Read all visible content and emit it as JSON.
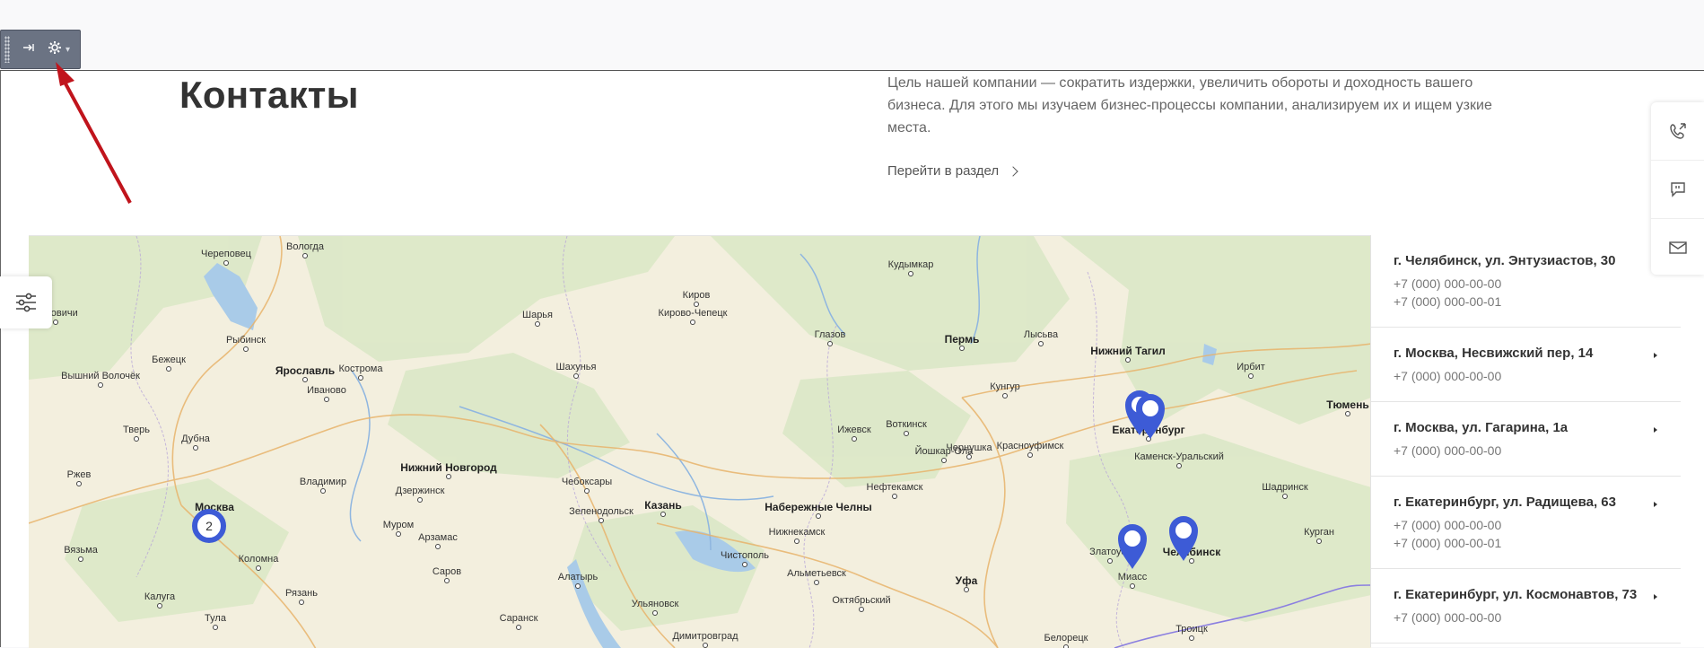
{
  "page": {
    "title": "Контакты",
    "intro": "Цель нашей компании — сократить издержки, увеличить обороты и доходность вашего бизнеса. Для этого мы изучаем бизнес-процессы компании, анализируем их и ищем узкие места.",
    "section_link": "Перейти в раздел"
  },
  "admin_toolbar": {
    "icons": [
      "grip-icon",
      "pin-icon",
      "gear-icon",
      "chevron-down-icon"
    ],
    "accent": "#6b7383"
  },
  "map": {
    "cluster_count": "2",
    "marker_color": "#3d5bd6",
    "cities": [
      {
        "name": "Череповец"
      },
      {
        "name": "Вологда"
      },
      {
        "name": "Кудымкар"
      },
      {
        "name": "Киров"
      },
      {
        "name": "Кирово-Чепецк"
      },
      {
        "name": "Шарья"
      },
      {
        "name": "Глазов"
      },
      {
        "name": "Пермь"
      },
      {
        "name": "Лысьва"
      },
      {
        "name": "Нижний Тагил"
      },
      {
        "name": "Ирбит"
      },
      {
        "name": "Боровичи"
      },
      {
        "name": "Рыбинск"
      },
      {
        "name": "Бежецк"
      },
      {
        "name": "Вышний Волочёк"
      },
      {
        "name": "Ярославль"
      },
      {
        "name": "Кострома"
      },
      {
        "name": "Шахунья"
      },
      {
        "name": "Кунгур"
      },
      {
        "name": "Екатеринбург"
      },
      {
        "name": "Тюмень"
      },
      {
        "name": "Иваново"
      },
      {
        "name": "Тверь"
      },
      {
        "name": "Дубна"
      },
      {
        "name": "Ижевск"
      },
      {
        "name": "Воткинск"
      },
      {
        "name": "Йошкар-Ола"
      },
      {
        "name": "Чернушка"
      },
      {
        "name": "Красноуфимск"
      },
      {
        "name": "Каменск-Уральский"
      },
      {
        "name": "Ржев"
      },
      {
        "name": "Владимир"
      },
      {
        "name": "Нижний Новгород"
      },
      {
        "name": "Чебоксары"
      },
      {
        "name": "Нефтекамск"
      },
      {
        "name": "Шадринск"
      },
      {
        "name": "Дзержинск"
      },
      {
        "name": "Москва"
      },
      {
        "name": "Зеленодольск"
      },
      {
        "name": "Казань"
      },
      {
        "name": "Набережные Челны"
      },
      {
        "name": "Муром"
      },
      {
        "name": "Нижнекамск"
      },
      {
        "name": "Курган"
      },
      {
        "name": "Вязьма"
      },
      {
        "name": "Арзамас"
      },
      {
        "name": "Коломна"
      },
      {
        "name": "Чистополь"
      },
      {
        "name": "Златоуст"
      },
      {
        "name": "Челябинск"
      },
      {
        "name": "Саров"
      },
      {
        "name": "Альметьевск"
      },
      {
        "name": "Миасс"
      },
      {
        "name": "Алатырь"
      },
      {
        "name": "Рязань"
      },
      {
        "name": "Уфа"
      },
      {
        "name": "Калуга"
      },
      {
        "name": "Ульяновск"
      },
      {
        "name": "Октябрьский"
      },
      {
        "name": "Саранск"
      },
      {
        "name": "Тула"
      },
      {
        "name": "Димитровград"
      },
      {
        "name": "Троицк"
      },
      {
        "name": "Белорецк"
      }
    ]
  },
  "contacts": [
    {
      "address": "г. Челябинск, ул. Энтузиастов, 30",
      "phones": [
        "+7 (000) 000-00-00",
        "+7 (000) 000-00-01"
      ]
    },
    {
      "address": "г. Москва, Несвижский пер, 14",
      "phones": [
        "+7 (000) 000-00-00"
      ]
    },
    {
      "address": "г. Москва, ул. Гагарина, 1а",
      "phones": [
        "+7 (000) 000-00-00"
      ]
    },
    {
      "address": "г. Екатеринбург, ул. Радищева, 63",
      "phones": [
        "+7 (000) 000-00-00",
        "+7 (000) 000-00-01"
      ]
    },
    {
      "address": "г. Екатеринбург, ул. Космонавтов, 73",
      "phones": [
        "+7 (000) 000-00-00"
      ]
    }
  ],
  "side_widget": {
    "icons": [
      "callback-phone-icon",
      "chat-bubble-icon",
      "mail-icon"
    ]
  },
  "filter_button": {
    "icon": "filter-sliders-icon"
  }
}
